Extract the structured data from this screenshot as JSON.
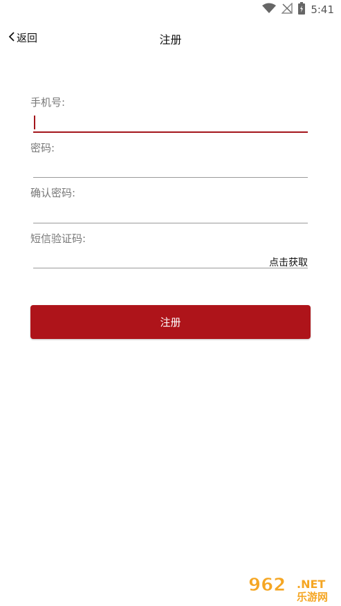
{
  "status_bar": {
    "time": "5:41",
    "icons": [
      "wifi-icon",
      "no-signal-icon",
      "battery-icon"
    ]
  },
  "header": {
    "back_label": "返回",
    "title": "注册"
  },
  "form": {
    "phone_label": "手机号:",
    "phone_value": "",
    "password_label": "密码:",
    "password_value": "",
    "confirm_label": "确认密码:",
    "confirm_value": "",
    "sms_label": "短信验证码:",
    "sms_value": "",
    "get_code_label": "点击获取",
    "submit_label": "注册"
  },
  "watermark": {
    "number_text": "962",
    "net_text": ".NET",
    "brand_text": "乐游网"
  },
  "colors": {
    "accent": "#ae141a",
    "divider": "#9a9a9a",
    "label": "#777777",
    "watermark_orange": "#f5a623"
  }
}
